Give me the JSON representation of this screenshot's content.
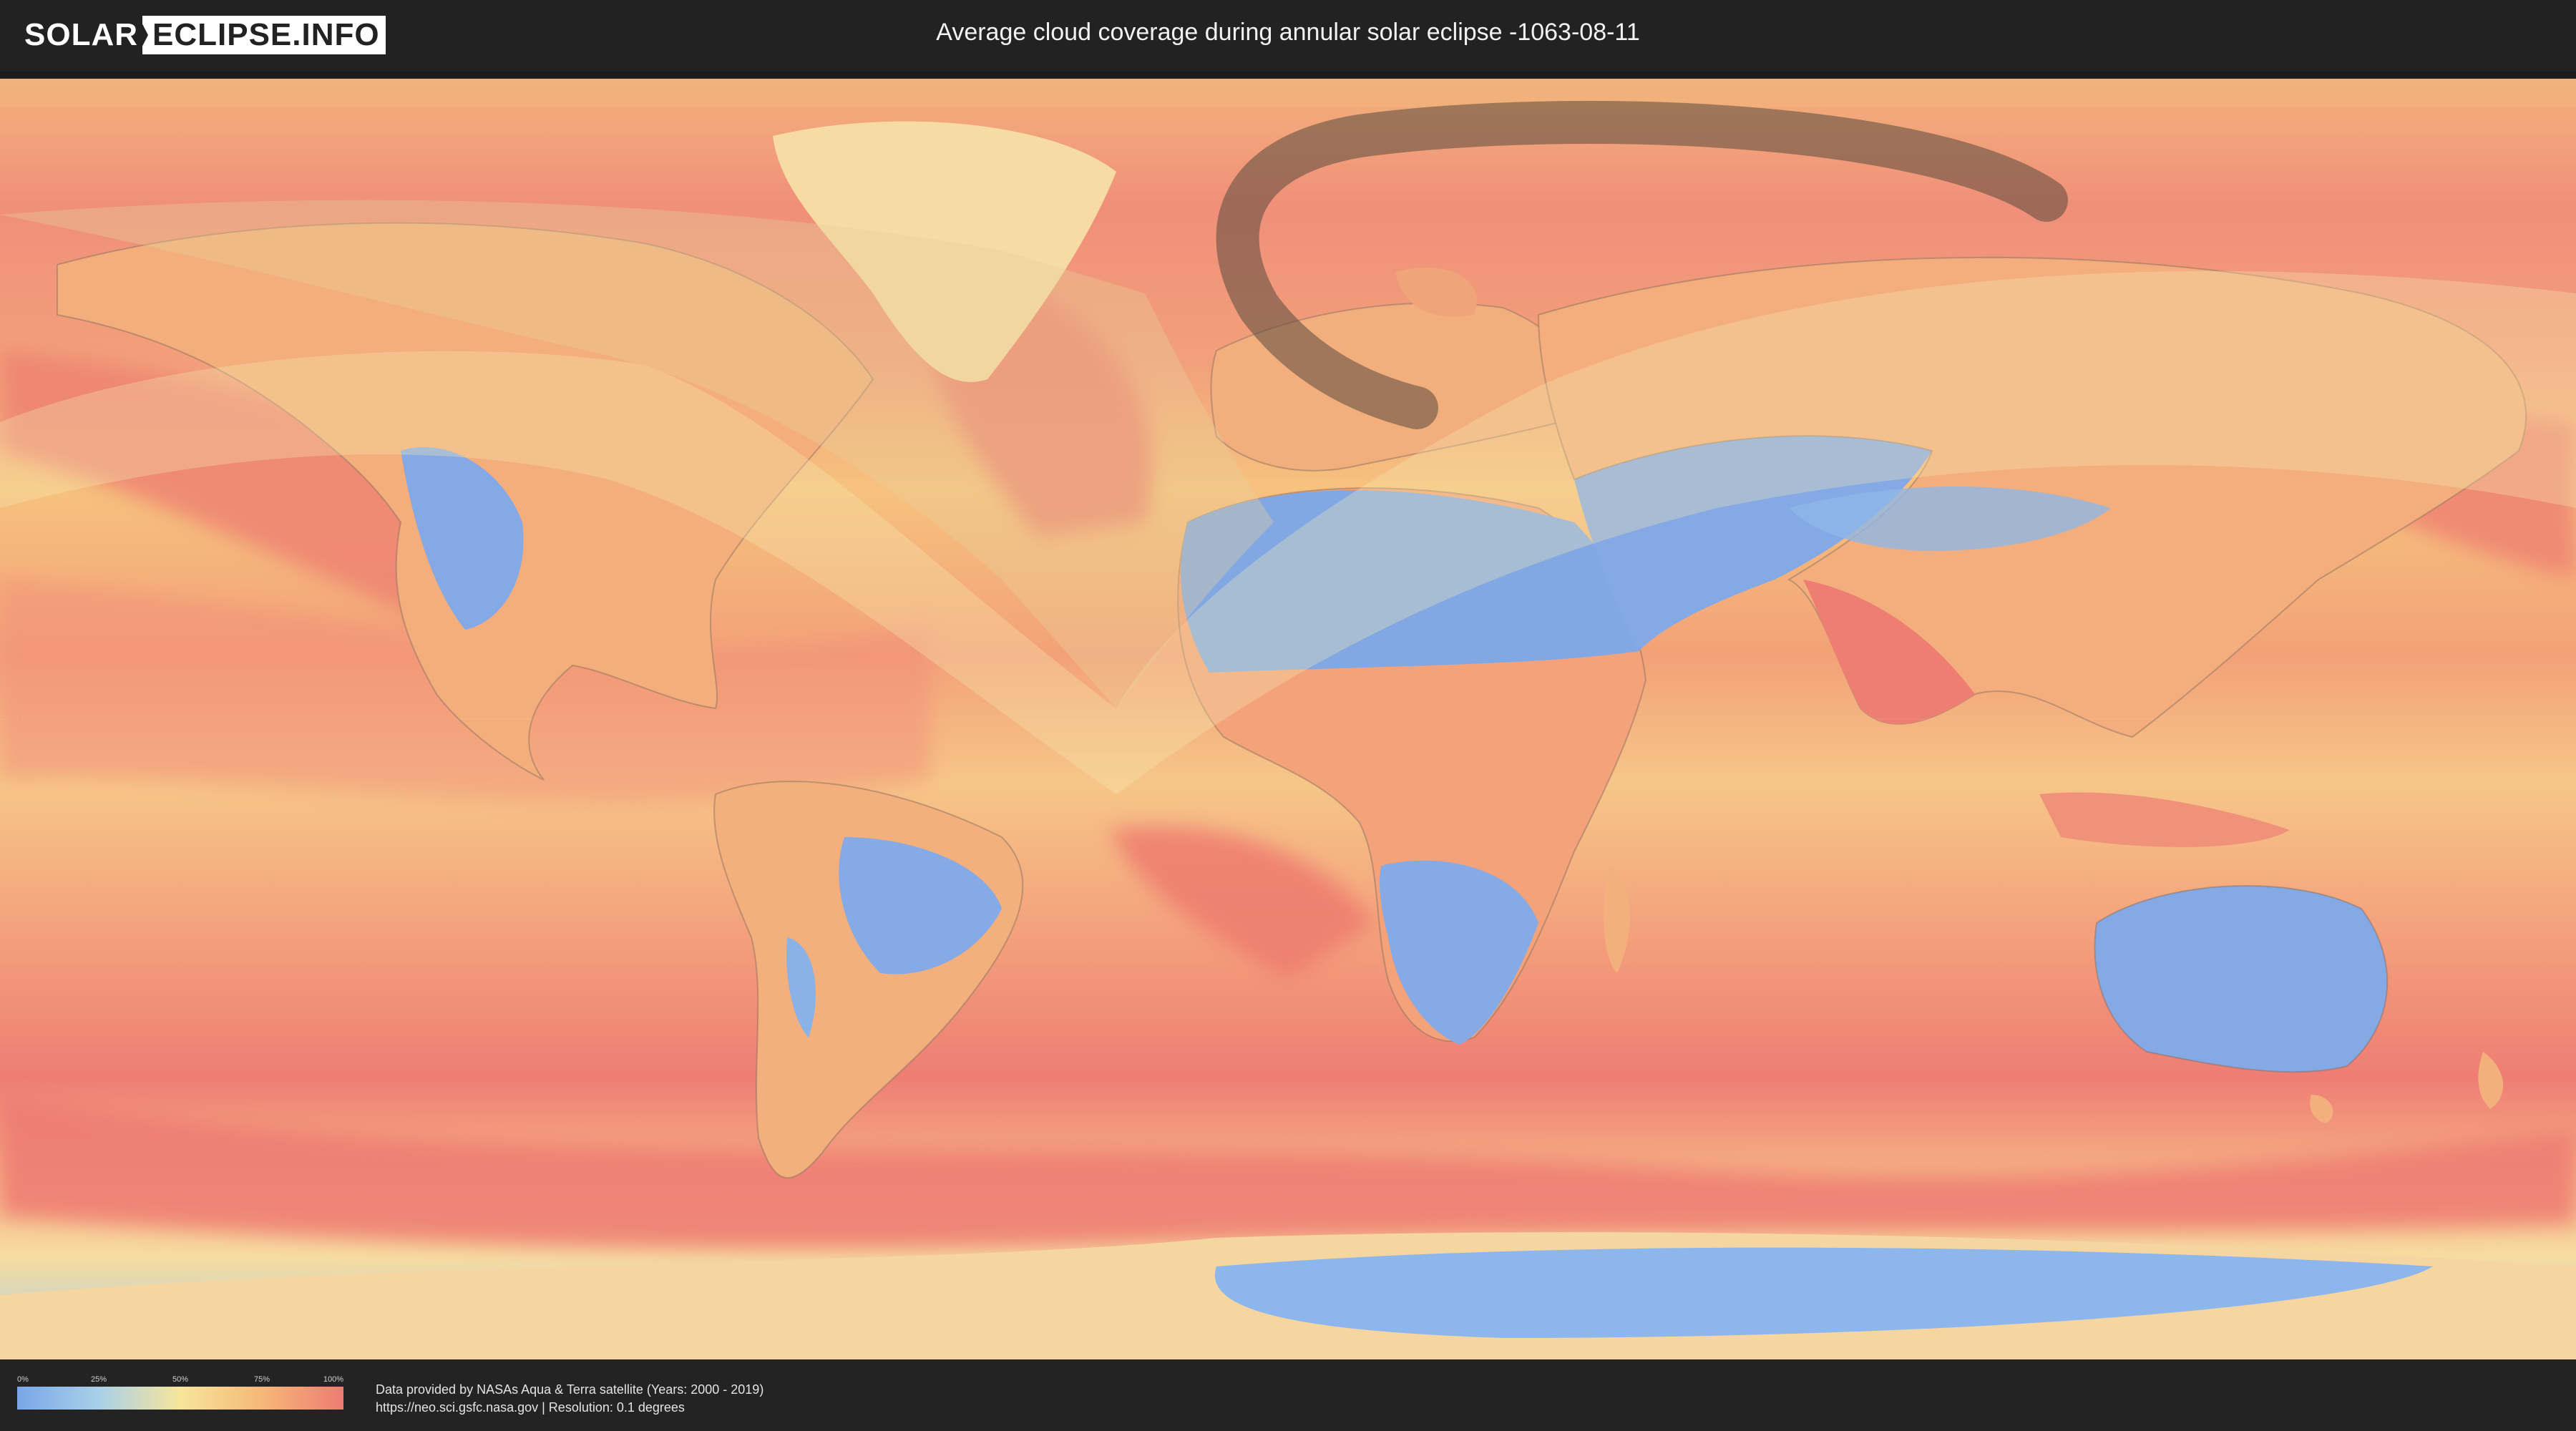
{
  "header": {
    "logo_left": "SOLAR",
    "logo_right": "ECLIPSE.INFO",
    "title": "Average cloud coverage during annular solar eclipse -1063-08-11"
  },
  "legend": {
    "ticks": [
      "0%",
      "25%",
      "50%",
      "75%",
      "100%"
    ],
    "gradient_colors": [
      "#7aa6e8",
      "#a8d0e8",
      "#f6e59a",
      "#f5b878",
      "#ee7b72"
    ]
  },
  "credits": {
    "line1": "Data provided by NASAs Aqua & Terra satellite (Years: 2000 - 2019)",
    "line2": "https://neo.sci.gsfc.nasa.gov | Resolution: 0.1 degrees"
  },
  "colors": {
    "ocean_cloudy": "#ef8a78",
    "ocean_mid": "#f5b27c",
    "land_clear": "#82a8e4",
    "ice_clear": "#8cb6ec",
    "path": "#5a4b3c",
    "penumbra": "#f3e3a8"
  }
}
